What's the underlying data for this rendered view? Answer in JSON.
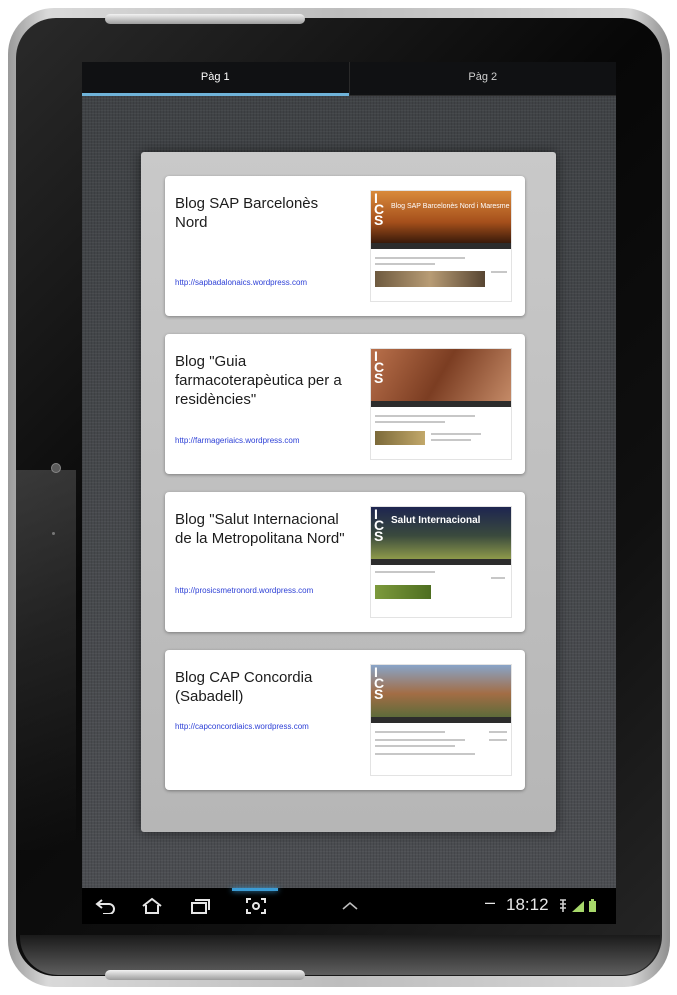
{
  "tabs": [
    {
      "label": "Pàg 1",
      "active": true
    },
    {
      "label": "Pàg 2",
      "active": false
    }
  ],
  "cards": [
    {
      "title": "Blog SAP Barcelonès Nord",
      "url": "http://sapbadalonaics.wordpress.com",
      "thumbnail_banner": "Blog SAP Barcelonès Nord i Maresme"
    },
    {
      "title": "Blog \"Guia farmacoterapèutica per a residències\"",
      "url": "http://farmageriaics.wordpress.com",
      "thumbnail_banner": ""
    },
    {
      "title": "Blog \"Salut Internacional de la Metropolitana Nord\"",
      "url": "http://prosicsmetronord.wordpress.com",
      "thumbnail_banner": "Salut Internacional"
    },
    {
      "title": "Blog CAP Concordia (Sabadell)",
      "url": "http://capconcordiaics.wordpress.com",
      "thumbnail_banner": ""
    }
  ],
  "thumbnail_logo": "ICS",
  "status_bar": {
    "minus": "–",
    "time": "18:12"
  },
  "icons": {
    "back": "back-icon",
    "home": "home-icon",
    "recent": "recent-apps-icon",
    "screenshot": "screenshot-icon",
    "up": "chevron-up-icon",
    "usb": "usb-icon",
    "signal": "signal-icon",
    "battery": "battery-icon"
  },
  "colors": {
    "tab_indicator": "#6fb3d9",
    "link": "#2c3fd6",
    "nav_glow": "#3b9bd4"
  }
}
